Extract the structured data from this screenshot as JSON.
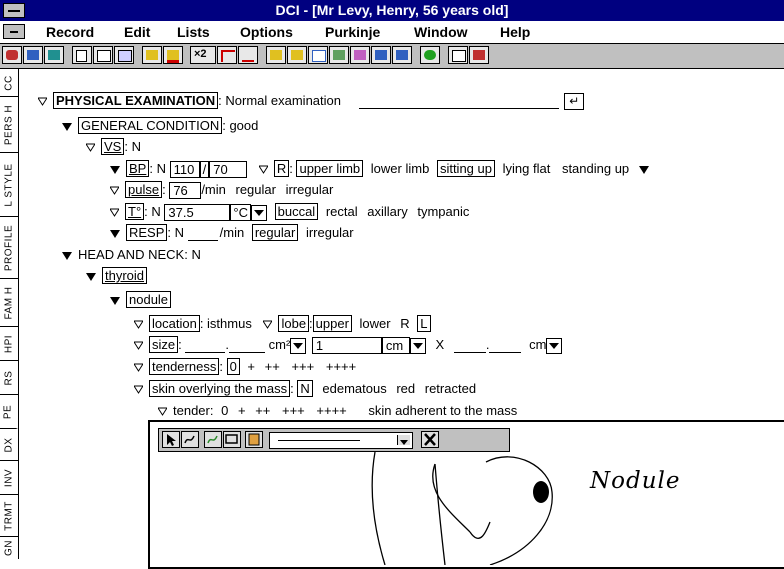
{
  "window": {
    "title": "DCI - [Mr Levy, Henry, 56 years old]"
  },
  "menu": {
    "items": [
      {
        "label": "Record"
      },
      {
        "label": "Edit"
      },
      {
        "label": "Lists"
      },
      {
        "label": "Options"
      },
      {
        "label": "Purkinje"
      },
      {
        "label": "Window"
      },
      {
        "label": "Help"
      }
    ]
  },
  "toolbar": {
    "x2_label": "×2"
  },
  "side_tabs": [
    "CC",
    "PERS H",
    "L STYLE",
    "PROFILE",
    "FAM H",
    "HPI",
    "RS",
    "PE",
    "DX",
    "INV",
    "TRMT",
    "GN"
  ],
  "exam": {
    "physical": {
      "label": "PHYSICAL EXAMINATION",
      "value": "Normal examination"
    },
    "general": {
      "label": "GENERAL CONDITION",
      "value": "good"
    },
    "vs": {
      "label": "VS",
      "value": "N"
    },
    "bp": {
      "label": "BP",
      "n": "N",
      "systolic": "110",
      "sep": "/",
      "diastolic": "70",
      "side": "R",
      "opt1": "upper limb",
      "opt2": "lower limb",
      "opt3": "sitting up",
      "opt4": "lying flat",
      "opt5": "standing up"
    },
    "pulse": {
      "label": "pulse",
      "value": "76",
      "unit": "/min",
      "opt1": "regular",
      "opt2": "irregular"
    },
    "temp": {
      "label": "T°",
      "n": "N",
      "value": "37.5",
      "unit": "°C",
      "opt1": "buccal",
      "opt2": "rectal",
      "opt3": "axillary",
      "opt4": "tympanic"
    },
    "resp": {
      "label": "RESP",
      "n": "N",
      "unit": "/min",
      "opt1": "regular",
      "opt2": "irregular"
    },
    "head_neck": {
      "label": "HEAD AND NECK",
      "value": "N"
    },
    "thyroid": {
      "label": "thyroid"
    },
    "nodule": {
      "label": "nodule"
    },
    "location": {
      "label": "location",
      "value": "isthmus",
      "lobe_label": "lobe",
      "opt1": "upper",
      "opt2": "lower",
      "r": "R",
      "l": "L"
    },
    "size": {
      "label": "size",
      "dot": ".",
      "unit1": "cm²",
      "value2": "1",
      "unit2": "cm",
      "x": "X",
      "dot2": ".",
      "unit3": "cm"
    },
    "tenderness": {
      "label": "tenderness",
      "value": "0",
      "o1": "+",
      "o2": "++",
      "o3": "+++",
      "o4": "++++"
    },
    "skin": {
      "label": "skin overlying the mass",
      "n": "N",
      "opt1": "edematous",
      "opt2": "red",
      "opt3": "retracted"
    },
    "tender_line": {
      "label": "tender",
      "value": "0",
      "o1": "+",
      "o2": "++",
      "o3": "+++",
      "o4": "++++",
      "adherent": "skin adherent to the mass"
    }
  },
  "drawing": {
    "annotation": "Nodule"
  }
}
